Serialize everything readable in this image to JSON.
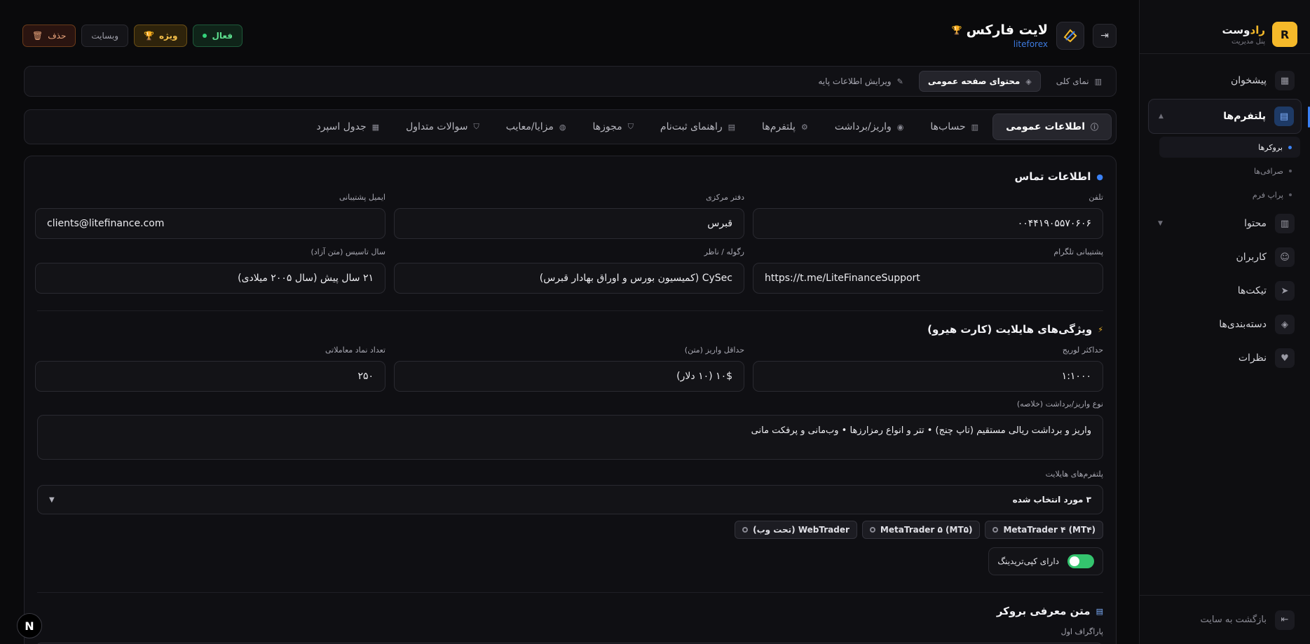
{
  "sidebar": {
    "brand_letter": "R",
    "brand_accent": "راد",
    "brand_rest": "وست",
    "brand_sub": "پنل مدیریت",
    "items": [
      {
        "label": "پیشخوان",
        "icon": "dashboard-icon"
      },
      {
        "label": "پلتفرم‌ها",
        "icon": "building-icon",
        "active": true
      },
      {
        "label": "محتوا",
        "icon": "document-icon"
      },
      {
        "label": "کاربران",
        "icon": "users-icon"
      },
      {
        "label": "تیکت‌ها",
        "icon": "send-icon"
      },
      {
        "label": "دسته‌بندی‌ها",
        "icon": "tag-icon"
      },
      {
        "label": "نظرات",
        "icon": "comment-icon"
      }
    ],
    "subitems": [
      "بروکرها",
      "صرافی‌ها",
      "پراپ فرم"
    ],
    "back_label": "بازگشت به سایت"
  },
  "header": {
    "title": "لایت فارکس",
    "slug": "liteforex",
    "status_label": "فعال",
    "featured_label": "ویژه",
    "website_label": "وبسایت",
    "delete_label": "حذف"
  },
  "view_tabs": [
    "نمای کلی",
    "محتوای صفحه عمومی",
    "ویرایش اطلاعات پایه"
  ],
  "content_tabs": [
    "اطلاعات عمومی",
    "حساب‌ها",
    "واریز/برداشت",
    "پلتفرم‌ها",
    "راهنمای ثبت‌نام",
    "مجوزها",
    "مزایا/معایب",
    "سوالات متداول",
    "جدول اسپرد"
  ],
  "contact": {
    "section_title": "اطلاعات تماس",
    "phone_label": "تلفن",
    "phone_value": "۰۰۴۴۱۹۰۵۵۷۰۶۰۶",
    "office_label": "دفتر مرکزی",
    "office_value": "قبرس",
    "email_label": "ایمیل پشتیبانی",
    "email_value": "clients@litefinance.com",
    "telegram_label": "پشتیبانی تلگرام",
    "telegram_value": "https://t.me/LiteFinanceSupport",
    "regulator_label": "رگوله / ناظر",
    "regulator_value": "CySec (کمیسیون بورس و اوراق بهادار قبرس)",
    "founded_label": "سال تاسیس (متن آزاد)",
    "founded_value": "۲۱ سال پیش (سال ۲۰۰۵ میلادی)"
  },
  "highlights": {
    "section_title": "ویژگی‌های هایلایت (کارت هیرو)",
    "leverage_label": "حداکثر لوریج",
    "leverage_value": "۱:۱۰۰۰",
    "min_deposit_label": "حداقل واریز (متن)",
    "min_deposit_value": "۱۰$ (۱۰ دلار)",
    "symbols_label": "تعداد نماد معاملاتی",
    "symbols_value": "۲۵۰",
    "payment_label": "نوع واریز/برداشت (خلاصه)",
    "payment_value": "واریز و برداشت ریالی مستقیم (تاپ چنج) • تتر و انواع رمزارزها • وب‌مانی و پرفکت مانی",
    "platforms_label": "پلتفرم‌های هایلایت",
    "platforms_selected": "۳ مورد انتخاب شده",
    "platform_chips": [
      "MetaTrader ۴ (MT۴)",
      "MetaTrader ۵ (MT۵)",
      "WebTrader (تحت وب)"
    ],
    "copytrading_label": "دارای کپی‌تریدینگ",
    "copytrading_on": true
  },
  "intro": {
    "section_title": "متن معرفی بروکر",
    "paragraph1_label": "پاراگراف اول"
  },
  "colors": {
    "accent": "#f5b92a",
    "primary": "#3b82f6",
    "success": "#34c46e"
  }
}
